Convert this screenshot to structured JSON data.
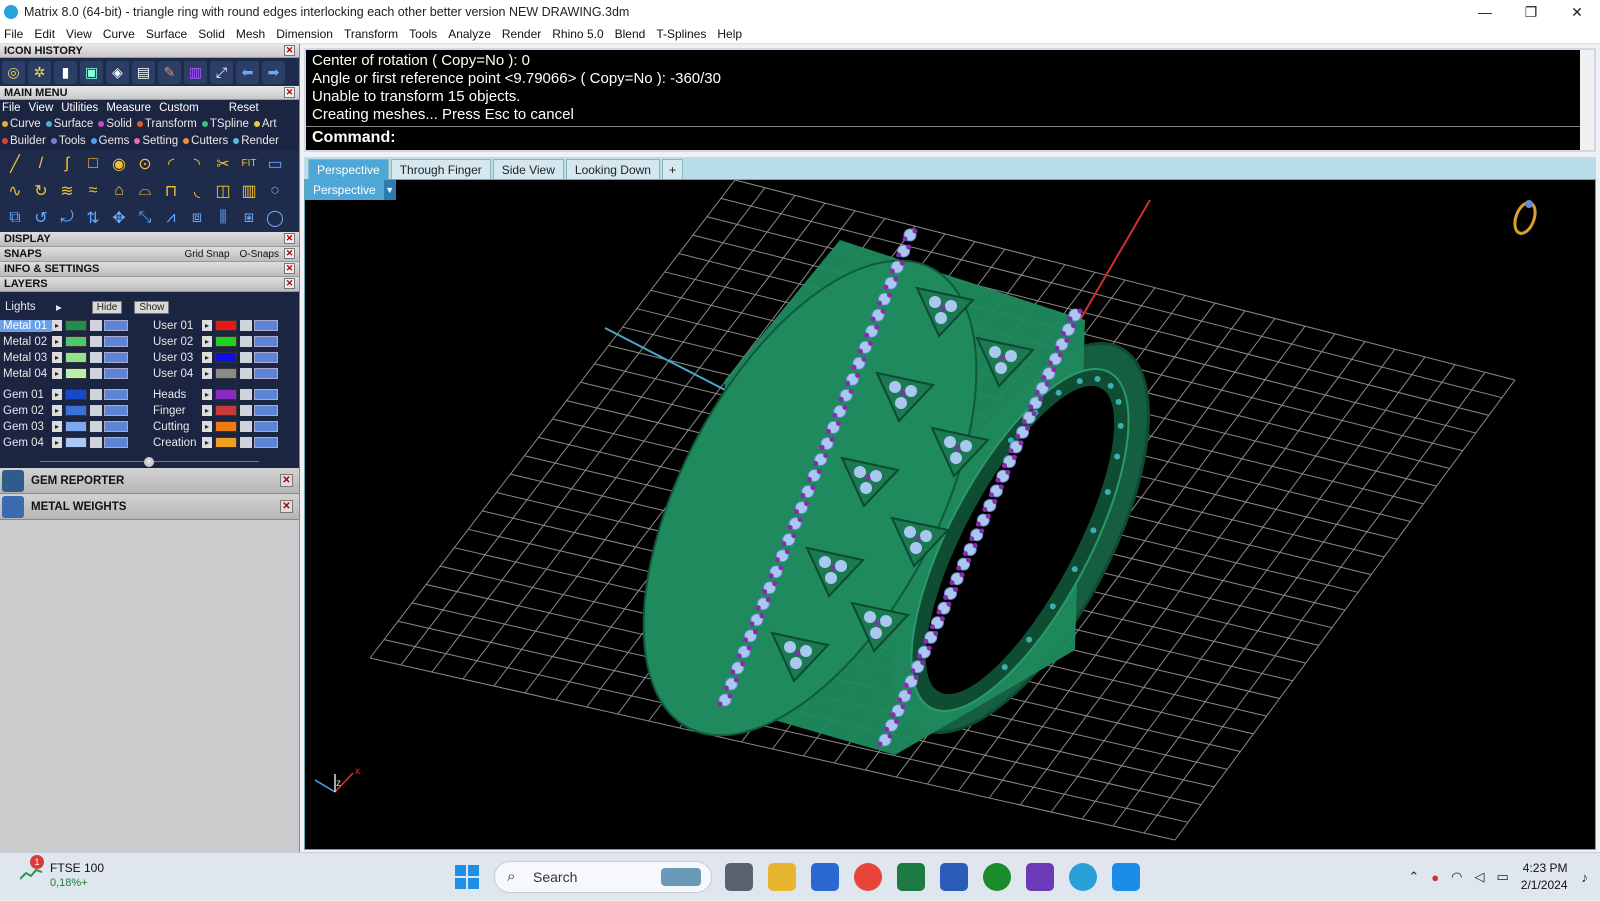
{
  "window": {
    "title": "Matrix 8.0 (64-bit) - triangle ring with round edges interlocking each other better version NEW DRAWING.3dm",
    "controls": [
      "—",
      "❐",
      "✕"
    ]
  },
  "menubar": [
    "File",
    "Edit",
    "View",
    "Curve",
    "Surface",
    "Solid",
    "Mesh",
    "Dimension",
    "Transform",
    "Tools",
    "Analyze",
    "Render",
    "Rhino 5.0",
    "Blend",
    "T-Splines",
    "Help"
  ],
  "left": {
    "icon_history": "ICON HISTORY",
    "main_menu": "MAIN MENU",
    "main_menu_items": [
      "File",
      "View",
      "Utilities",
      "Measure",
      "Custom"
    ],
    "reset": "Reset",
    "categories_row1": [
      {
        "label": "Curve",
        "color": "#e0b030"
      },
      {
        "label": "Surface",
        "color": "#4fb0d0"
      },
      {
        "label": "Solid",
        "color": "#c050c0"
      },
      {
        "label": "Transform",
        "color": "#e06020"
      },
      {
        "label": "TSpline",
        "color": "#40c080"
      },
      {
        "label": "Art",
        "color": "#e0d040"
      }
    ],
    "categories_row2": [
      {
        "label": "Builder",
        "color": "#e04040"
      },
      {
        "label": "Tools",
        "color": "#7080e0"
      },
      {
        "label": "Gems",
        "color": "#50a0f0"
      },
      {
        "label": "Setting",
        "color": "#e070b0"
      },
      {
        "label": "Cutters",
        "color": "#f09030"
      },
      {
        "label": "Render",
        "color": "#50c0e0"
      }
    ],
    "display": "DISPLAY",
    "snaps": "SNAPS",
    "grid_snap": "Grid Snap",
    "o_snaps": "O-Snaps",
    "info": "INFO & SETTINGS",
    "layers": "LAYERS",
    "lights": "Lights",
    "hide": "Hide",
    "show": "Show",
    "layers_left": [
      {
        "name": "Metal 01",
        "color": "#1f8f4e",
        "selected": true
      },
      {
        "name": "Metal 02",
        "color": "#4cc770"
      },
      {
        "name": "Metal 03",
        "color": "#8fe38f"
      },
      {
        "name": "Metal 04",
        "color": "#b9f0b0"
      },
      {
        "name": "Gem 01",
        "color": "#1848c8"
      },
      {
        "name": "Gem 02",
        "color": "#3d6fd8"
      },
      {
        "name": "Gem 03",
        "color": "#7ca8ee"
      },
      {
        "name": "Gem 04",
        "color": "#a9c7f5"
      }
    ],
    "layers_right": [
      {
        "name": "User 01",
        "color": "#e81818"
      },
      {
        "name": "User 02",
        "color": "#22d022"
      },
      {
        "name": "User 03",
        "color": "#1010e0"
      },
      {
        "name": "User 04",
        "color": "#8a8a8a"
      },
      {
        "name": "Heads",
        "color": "#8a2ac0"
      },
      {
        "name": "Finger",
        "color": "#c83a3a"
      },
      {
        "name": "Cutting",
        "color": "#f07a10"
      },
      {
        "name": "Creation",
        "color": "#f0a020"
      }
    ],
    "gem_reporter": "GEM REPORTER",
    "metal_weights": "METAL WEIGHTS"
  },
  "command": {
    "lines": [
      "Center of rotation ( Copy=No ): 0",
      "Angle or first reference point <9.79066> ( Copy=No ): -360/30",
      "Unable to transform 15 objects.",
      "Creating meshes... Press Esc to cancel"
    ],
    "prompt": "Command:"
  },
  "viewport_tabs": [
    "Perspective",
    "Through Finger",
    "Side View",
    "Looking Down",
    "+"
  ],
  "viewport": {
    "selector": "Perspective",
    "axis_z": "z",
    "axis_x": "x",
    "colors": {
      "metal": "#1f8a5e",
      "gem": "#a9c8f0",
      "prong": "#8a2ab0"
    }
  },
  "taskbar": {
    "stock_badge": "1",
    "stock_name": "FTSE 100",
    "stock_change": "0,18%+",
    "search": "Search",
    "time": "4:23 PM",
    "date": "2/1/2024"
  }
}
